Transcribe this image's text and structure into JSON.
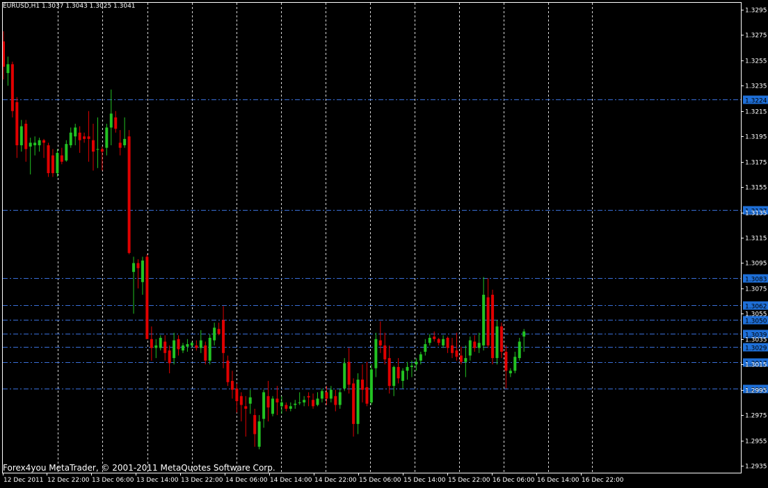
{
  "header": {
    "symbol_line": "EURUSD,H1  1.3037 1.3043 1.3025 1.3041"
  },
  "footer": {
    "copyright": "Forex4you MetaTrader, © 2001-2011 MetaQuotes Software Corp."
  },
  "colors": {
    "background": "#000000",
    "frame": "#ffffff",
    "bull": "#22c322",
    "bear": "#e00000",
    "grid": "#ffffff",
    "hline": "#3a6fd8",
    "tag_bg": "#1e6fd8",
    "tag_text": "#000000"
  },
  "chart_data": {
    "type": "candlestick",
    "symbol": "EURUSD",
    "timeframe": "H1",
    "ylim": [
      1.2928,
      1.3303
    ],
    "y_ticks": [
      "1.3295",
      "1.3275",
      "1.3255",
      "1.3235",
      "1.3215",
      "1.3195",
      "1.3175",
      "1.3155",
      "1.3135",
      "1.3115",
      "1.3095",
      "1.3075",
      "1.3055",
      "1.3035",
      "1.3015",
      "1.2995",
      "1.2975",
      "1.2955",
      "1.2935"
    ],
    "x_ticks": [
      "12 Dec 2011",
      "12 Dec 22:00",
      "13 Dec 06:00",
      "13 Dec 14:00",
      "13 Dec 22:00",
      "14 Dec 06:00",
      "14 Dec 14:00",
      "14 Dec 22:00",
      "15 Dec 06:00",
      "15 Dec 14:00",
      "15 Dec 22:00",
      "16 Dec 06:00",
      "16 Dec 14:00",
      "16 Dec 22:00"
    ],
    "horizontal_lines": [
      "1.3224",
      "1.3137",
      "1.3083",
      "1.3062",
      "1.3050",
      "1.3039",
      "1.3029",
      "1.3017",
      "1.2996"
    ],
    "grid": true,
    "candles": [
      {
        "o": 1.327,
        "h": 1.3278,
        "l": 1.324,
        "c": 1.325
      },
      {
        "o": 1.3245,
        "h": 1.3258,
        "l": 1.3235,
        "c": 1.3252
      },
      {
        "o": 1.3252,
        "h": 1.3254,
        "l": 1.321,
        "c": 1.3215
      },
      {
        "o": 1.3222,
        "h": 1.3226,
        "l": 1.3178,
        "c": 1.3188
      },
      {
        "o": 1.3188,
        "h": 1.3208,
        "l": 1.3183,
        "c": 1.3203
      },
      {
        "o": 1.3205,
        "h": 1.3208,
        "l": 1.3175,
        "c": 1.3185
      },
      {
        "o": 1.3187,
        "h": 1.3194,
        "l": 1.3165,
        "c": 1.319
      },
      {
        "o": 1.3188,
        "h": 1.3195,
        "l": 1.318,
        "c": 1.319
      },
      {
        "o": 1.3188,
        "h": 1.3194,
        "l": 1.3183,
        "c": 1.3192
      },
      {
        "o": 1.3192,
        "h": 1.3193,
        "l": 1.3178,
        "c": 1.319
      },
      {
        "o": 1.3188,
        "h": 1.319,
        "l": 1.3163,
        "c": 1.3166
      },
      {
        "o": 1.318,
        "h": 1.3185,
        "l": 1.3163,
        "c": 1.3166
      },
      {
        "o": 1.3166,
        "h": 1.3185,
        "l": 1.3163,
        "c": 1.3182
      },
      {
        "o": 1.318,
        "h": 1.3186,
        "l": 1.3173,
        "c": 1.3175
      },
      {
        "o": 1.3176,
        "h": 1.3192,
        "l": 1.3175,
        "c": 1.3189
      },
      {
        "o": 1.3188,
        "h": 1.3202,
        "l": 1.3186,
        "c": 1.3198
      },
      {
        "o": 1.3195,
        "h": 1.3205,
        "l": 1.3188,
        "c": 1.3202
      },
      {
        "o": 1.3198,
        "h": 1.3203,
        "l": 1.3182,
        "c": 1.3192
      },
      {
        "o": 1.3195,
        "h": 1.3198,
        "l": 1.319,
        "c": 1.3193
      },
      {
        "o": 1.3195,
        "h": 1.3215,
        "l": 1.3175,
        "c": 1.3193
      },
      {
        "o": 1.3192,
        "h": 1.3205,
        "l": 1.3168,
        "c": 1.3183
      },
      {
        "o": 1.3185,
        "h": 1.321,
        "l": 1.317,
        "c": 1.3185
      },
      {
        "o": 1.3185,
        "h": 1.3187,
        "l": 1.3168,
        "c": 1.3183
      },
      {
        "o": 1.3186,
        "h": 1.3205,
        "l": 1.318,
        "c": 1.3202
      },
      {
        "o": 1.3202,
        "h": 1.3232,
        "l": 1.3188,
        "c": 1.3213
      },
      {
        "o": 1.321,
        "h": 1.3215,
        "l": 1.3198,
        "c": 1.3201
      },
      {
        "o": 1.319,
        "h": 1.32,
        "l": 1.318,
        "c": 1.3186
      },
      {
        "o": 1.3188,
        "h": 1.321,
        "l": 1.3186,
        "c": 1.3193
      },
      {
        "o": 1.3195,
        "h": 1.32,
        "l": 1.3102,
        "c": 1.3103
      },
      {
        "o": 1.3088,
        "h": 1.31,
        "l": 1.3055,
        "c": 1.3095
      },
      {
        "o": 1.3095,
        "h": 1.3098,
        "l": 1.3075,
        "c": 1.3091
      },
      {
        "o": 1.308,
        "h": 1.31,
        "l": 1.307,
        "c": 1.3097
      },
      {
        "o": 1.31,
        "h": 1.3102,
        "l": 1.3035,
        "c": 1.3035
      },
      {
        "o": 1.3035,
        "h": 1.3045,
        "l": 1.3018,
        "c": 1.3028
      },
      {
        "o": 1.3028,
        "h": 1.3035,
        "l": 1.302,
        "c": 1.303
      },
      {
        "o": 1.3028,
        "h": 1.3038,
        "l": 1.3026,
        "c": 1.3036
      },
      {
        "o": 1.3033,
        "h": 1.3038,
        "l": 1.3018,
        "c": 1.3024
      },
      {
        "o": 1.3026,
        "h": 1.303,
        "l": 1.3008,
        "c": 1.3016
      },
      {
        "o": 1.302,
        "h": 1.304,
        "l": 1.3015,
        "c": 1.3034
      },
      {
        "o": 1.3035,
        "h": 1.3038,
        "l": 1.3022,
        "c": 1.3027
      },
      {
        "o": 1.3026,
        "h": 1.3032,
        "l": 1.3024,
        "c": 1.303
      },
      {
        "o": 1.3029,
        "h": 1.3035,
        "l": 1.3025,
        "c": 1.3031
      },
      {
        "o": 1.303,
        "h": 1.3033,
        "l": 1.3028,
        "c": 1.3032
      },
      {
        "o": 1.303,
        "h": 1.3034,
        "l": 1.3026,
        "c": 1.3028
      },
      {
        "o": 1.3028,
        "h": 1.3042,
        "l": 1.3024,
        "c": 1.3034
      },
      {
        "o": 1.303,
        "h": 1.3033,
        "l": 1.3015,
        "c": 1.3018
      },
      {
        "o": 1.3018,
        "h": 1.3039,
        "l": 1.3015,
        "c": 1.3036
      },
      {
        "o": 1.3034,
        "h": 1.3048,
        "l": 1.303,
        "c": 1.3044
      },
      {
        "o": 1.3043,
        "h": 1.3048,
        "l": 1.3038,
        "c": 1.3039
      },
      {
        "o": 1.305,
        "h": 1.3061,
        "l": 1.3012,
        "c": 1.3024
      },
      {
        "o": 1.3018,
        "h": 1.3022,
        "l": 1.2998,
        "c": 1.3001
      },
      {
        "o": 1.3002,
        "h": 1.301,
        "l": 1.2988,
        "c": 1.2995
      },
      {
        "o": 1.2996,
        "h": 1.3,
        "l": 1.2977,
        "c": 1.2986
      },
      {
        "o": 1.299,
        "h": 1.2993,
        "l": 1.297,
        "c": 1.2983
      },
      {
        "o": 1.2982,
        "h": 1.299,
        "l": 1.2958,
        "c": 1.298
      },
      {
        "o": 1.2984,
        "h": 1.2995,
        "l": 1.2976,
        "c": 1.2989
      },
      {
        "o": 1.2975,
        "h": 1.298,
        "l": 1.295,
        "c": 1.296
      },
      {
        "o": 1.295,
        "h": 1.2975,
        "l": 1.2948,
        "c": 1.297
      },
      {
        "o": 1.2972,
        "h": 1.2995,
        "l": 1.2965,
        "c": 1.2993
      },
      {
        "o": 1.299,
        "h": 1.3002,
        "l": 1.297,
        "c": 1.2981
      },
      {
        "o": 1.2976,
        "h": 1.299,
        "l": 1.2974,
        "c": 1.2988
      },
      {
        "o": 1.2988,
        "h": 1.2998,
        "l": 1.2975,
        "c": 1.2985
      },
      {
        "o": 1.2982,
        "h": 1.299,
        "l": 1.2976,
        "c": 1.2985
      },
      {
        "o": 1.2983,
        "h": 1.2985,
        "l": 1.2978,
        "c": 1.298
      },
      {
        "o": 1.298,
        "h": 1.2985,
        "l": 1.2978,
        "c": 1.2982
      },
      {
        "o": 1.2983,
        "h": 1.2987,
        "l": 1.298,
        "c": 1.2984
      },
      {
        "o": 1.2985,
        "h": 1.2993,
        "l": 1.2983,
        "c": 1.2985
      },
      {
        "o": 1.2985,
        "h": 1.299,
        "l": 1.2982,
        "c": 1.2987
      },
      {
        "o": 1.299,
        "h": 1.2993,
        "l": 1.2982,
        "c": 1.2989
      },
      {
        "o": 1.2987,
        "h": 1.2992,
        "l": 1.298,
        "c": 1.2982
      },
      {
        "o": 1.2983,
        "h": 1.2993,
        "l": 1.2982,
        "c": 1.2988
      },
      {
        "o": 1.2988,
        "h": 1.2996,
        "l": 1.2985,
        "c": 1.2994
      },
      {
        "o": 1.2993,
        "h": 1.2998,
        "l": 1.2983,
        "c": 1.2988
      },
      {
        "o": 1.2988,
        "h": 1.2998,
        "l": 1.2985,
        "c": 1.2995
      },
      {
        "o": 1.299,
        "h": 1.2995,
        "l": 1.2978,
        "c": 1.2983
      },
      {
        "o": 1.2983,
        "h": 1.2996,
        "l": 1.298,
        "c": 1.2993
      },
      {
        "o": 1.2996,
        "h": 1.302,
        "l": 1.2994,
        "c": 1.3016
      },
      {
        "o": 1.3017,
        "h": 1.3028,
        "l": 1.2992,
        "c": 1.2999
      },
      {
        "o": 1.3,
        "h": 1.3004,
        "l": 1.2958,
        "c": 1.2968
      },
      {
        "o": 1.2968,
        "h": 1.3008,
        "l": 1.296,
        "c": 1.3003
      },
      {
        "o": 1.3003,
        "h": 1.3015,
        "l": 1.2985,
        "c": 1.2995
      },
      {
        "o": 1.2997,
        "h": 1.3017,
        "l": 1.2982,
        "c": 1.2984
      },
      {
        "o": 1.2985,
        "h": 1.3015,
        "l": 1.2983,
        "c": 1.3011
      },
      {
        "o": 1.3012,
        "h": 1.304,
        "l": 1.3005,
        "c": 1.3035
      },
      {
        "o": 1.3034,
        "h": 1.3049,
        "l": 1.3024,
        "c": 1.303
      },
      {
        "o": 1.303,
        "h": 1.304,
        "l": 1.3015,
        "c": 1.3019
      },
      {
        "o": 1.302,
        "h": 1.303,
        "l": 1.2992,
        "c": 1.2998
      },
      {
        "o": 1.2998,
        "h": 1.3014,
        "l": 1.299,
        "c": 1.3013
      },
      {
        "o": 1.3013,
        "h": 1.302,
        "l": 1.3,
        "c": 1.3004
      },
      {
        "o": 1.3002,
        "h": 1.3012,
        "l": 1.2996,
        "c": 1.301
      },
      {
        "o": 1.301,
        "h": 1.3017,
        "l": 1.3003,
        "c": 1.3013
      },
      {
        "o": 1.3013,
        "h": 1.3018,
        "l": 1.3005,
        "c": 1.3014
      },
      {
        "o": 1.3015,
        "h": 1.302,
        "l": 1.301,
        "c": 1.3017
      },
      {
        "o": 1.3018,
        "h": 1.3025,
        "l": 1.3015,
        "c": 1.3023
      },
      {
        "o": 1.3025,
        "h": 1.3035,
        "l": 1.3022,
        "c": 1.3031
      },
      {
        "o": 1.3032,
        "h": 1.3039,
        "l": 1.303,
        "c": 1.3036
      },
      {
        "o": 1.3037,
        "h": 1.3041,
        "l": 1.3033,
        "c": 1.3035
      },
      {
        "o": 1.3035,
        "h": 1.3036,
        "l": 1.303,
        "c": 1.3032
      },
      {
        "o": 1.303,
        "h": 1.3038,
        "l": 1.3028,
        "c": 1.3035
      },
      {
        "o": 1.3036,
        "h": 1.3037,
        "l": 1.3024,
        "c": 1.3028
      },
      {
        "o": 1.303,
        "h": 1.3036,
        "l": 1.302,
        "c": 1.3024
      },
      {
        "o": 1.3026,
        "h": 1.304,
        "l": 1.3018,
        "c": 1.3021
      },
      {
        "o": 1.3022,
        "h": 1.3029,
        "l": 1.3015,
        "c": 1.3017
      },
      {
        "o": 1.3017,
        "h": 1.303,
        "l": 1.3005,
        "c": 1.302
      },
      {
        "o": 1.3022,
        "h": 1.3037,
        "l": 1.3018,
        "c": 1.3034
      },
      {
        "o": 1.3033,
        "h": 1.3038,
        "l": 1.3025,
        "c": 1.3028
      },
      {
        "o": 1.3028,
        "h": 1.304,
        "l": 1.3024,
        "c": 1.3032
      },
      {
        "o": 1.303,
        "h": 1.3084,
        "l": 1.3026,
        "c": 1.307
      },
      {
        "o": 1.3068,
        "h": 1.3083,
        "l": 1.3028,
        "c": 1.303
      },
      {
        "o": 1.307,
        "h": 1.3074,
        "l": 1.3015,
        "c": 1.302
      },
      {
        "o": 1.302,
        "h": 1.305,
        "l": 1.3015,
        "c": 1.3045
      },
      {
        "o": 1.3045,
        "h": 1.3048,
        "l": 1.302,
        "c": 1.3025
      },
      {
        "o": 1.3025,
        "h": 1.303,
        "l": 1.2996,
        "c": 1.301
      },
      {
        "o": 1.3008,
        "h": 1.3012,
        "l": 1.3005,
        "c": 1.301
      },
      {
        "o": 1.301,
        "h": 1.3025,
        "l": 1.3008,
        "c": 1.3021
      },
      {
        "o": 1.302,
        "h": 1.3036,
        "l": 1.3018,
        "c": 1.3033
      },
      {
        "o": 1.3037,
        "h": 1.3043,
        "l": 1.3025,
        "c": 1.3041
      }
    ]
  }
}
